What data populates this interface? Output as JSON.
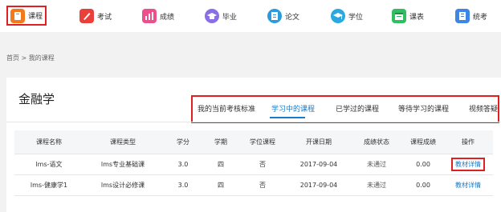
{
  "nav": {
    "items": [
      {
        "label": "课程",
        "color": "#f27a1a"
      },
      {
        "label": "考试",
        "color": "#e8403a"
      },
      {
        "label": "成绩",
        "color": "#ec4f8c"
      },
      {
        "label": "毕业",
        "color": "#8a6ee6"
      },
      {
        "label": "论文",
        "color": "#2a9bdc"
      },
      {
        "label": "学位",
        "color": "#29a9e0"
      },
      {
        "label": "课表",
        "color": "#2fbf62"
      },
      {
        "label": "统考",
        "color": "#3d86e6"
      }
    ]
  },
  "breadcrumb": "首页 > 我的课程",
  "card": {
    "title": "金融学",
    "tabs": [
      "我的当前考核标准",
      "学习中的课程",
      "已学过的课程",
      "等待学习的课程",
      "视频答疑"
    ],
    "active_tab": "学习中的课程"
  },
  "table": {
    "headers": [
      "课程名称",
      "课程类型",
      "学分",
      "学期",
      "学位课程",
      "开课日期",
      "成绩状态",
      "课程成绩",
      "操作"
    ],
    "rows": [
      {
        "name": "lms-语文",
        "type": "lms专业基础课",
        "credit": "3.0",
        "term": "四",
        "degree": "否",
        "date": "2017-09-04",
        "status": "未通过",
        "score": "0.00",
        "action": "教材详情"
      },
      {
        "name": "lms-健康学1",
        "type": "lms设计必修课",
        "credit": "3.0",
        "term": "四",
        "degree": "否",
        "date": "2017-09-04",
        "status": "未通过",
        "score": "0.00",
        "action": "教材详情"
      }
    ]
  },
  "colors": {
    "accent": "#1a7bc6",
    "highlight": "#e02020"
  }
}
